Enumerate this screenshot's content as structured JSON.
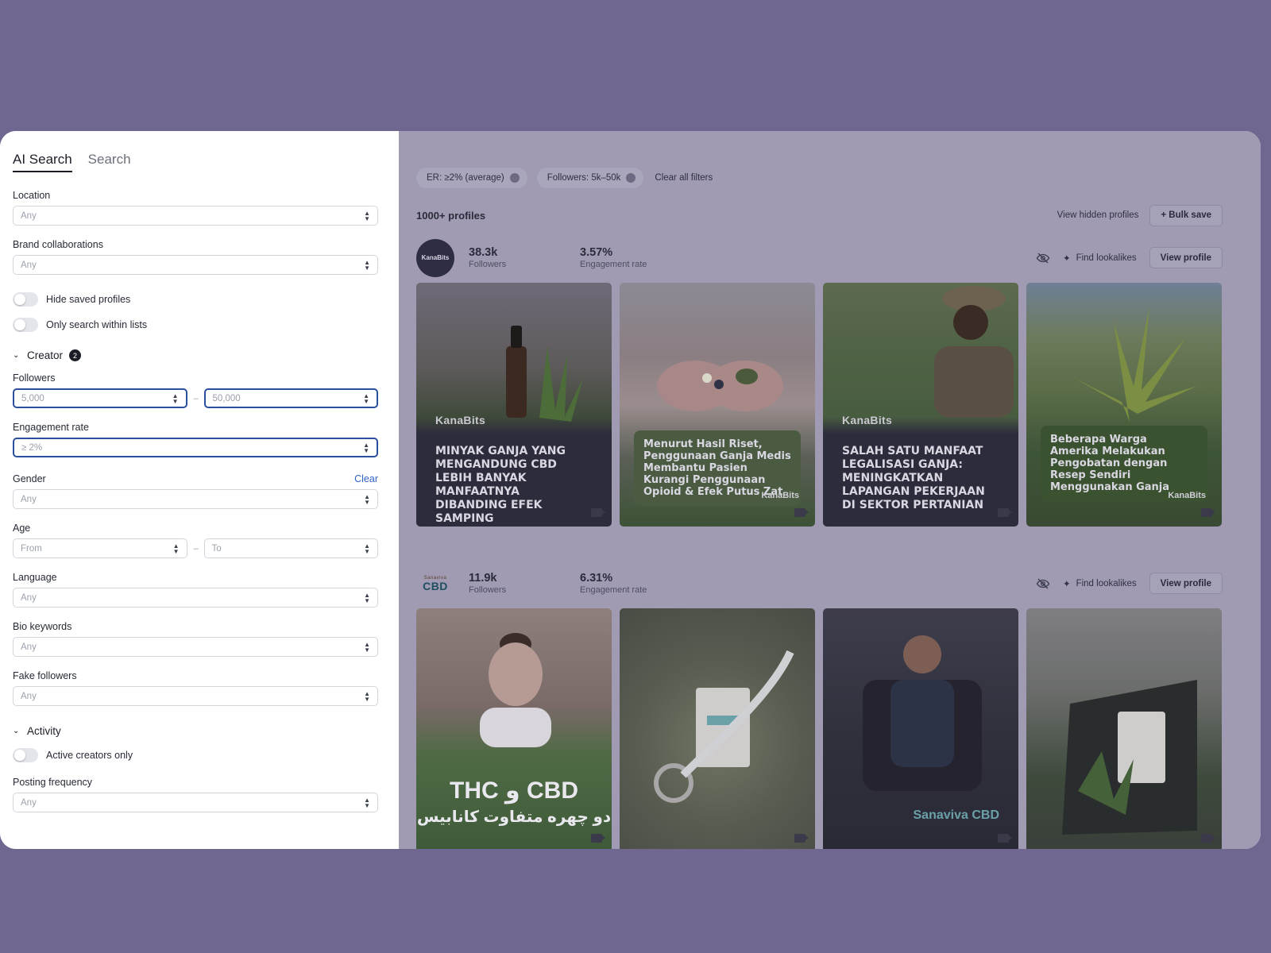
{
  "sidebar": {
    "tabs": [
      {
        "label": "AI Search"
      },
      {
        "label": "Search"
      }
    ],
    "location": {
      "label": "Location",
      "value": "Any"
    },
    "brand_collaborations": {
      "label": "Brand collaborations",
      "value": "Any"
    },
    "toggles": [
      {
        "label": "Hide saved profiles"
      },
      {
        "label": "Only search within lists"
      }
    ],
    "creator": {
      "title": "Creator",
      "badge": "2",
      "followers": {
        "label": "Followers",
        "min": "5,000",
        "max": "50,000"
      },
      "engagement": {
        "label": "Engagement rate",
        "value": "≥ 2%"
      },
      "gender": {
        "label": "Gender",
        "clear": "Clear",
        "value": "Any"
      },
      "age": {
        "label": "Age",
        "from": "From",
        "to": "To"
      },
      "language": {
        "label": "Language",
        "value": "Any"
      },
      "bio": {
        "label": "Bio keywords",
        "value": "Any"
      },
      "fake": {
        "label": "Fake followers",
        "value": "Any"
      }
    },
    "activity": {
      "title": "Activity",
      "toggle": "Active creators only",
      "posting": {
        "label": "Posting frequency",
        "value": "Any"
      }
    }
  },
  "main": {
    "filters": [
      {
        "label": "ER: ≥2% (average)"
      },
      {
        "label": "Followers: 5k–50k"
      }
    ],
    "clear_all": "Clear all filters",
    "results_count": "1000+ profiles",
    "view_hidden": "View hidden profiles",
    "bulk_save": "+ Bulk save",
    "profiles": [
      {
        "avatar": "KanaBits",
        "followers": "38.3k",
        "followers_label": "Followers",
        "er": "3.57%",
        "er_label": "Engagement rate",
        "lookalikes": "Find lookalikes",
        "view": "View profile",
        "posts": [
          {
            "brand": "KanaBits",
            "caption": "MINYAK GANJA YANG MENGANDUNG CBD LEBIH BANYAK MANFAATNYA DIBANDING EFEK SAMPING"
          },
          {
            "caption": "Menurut Hasil Riset, Penggunaan Ganja Medis Membantu Pasien Kurangi Penggunaan Opioid & Efek Putus Zat",
            "brand": "KanaBits"
          },
          {
            "brand": "KanaBits",
            "caption": "SALAH SATU MANFAAT LEGALISASI GANJA: MENINGKATKAN LAPANGAN PEKERJAAN DI SEKTOR PERTANIAN"
          },
          {
            "caption": "Beberapa Warga Amerika Melakukan Pengobatan dengan Resep Sendiri Menggunakan Ganja",
            "brand": "KanaBits"
          }
        ]
      },
      {
        "avatar_top": "Sanaviva",
        "avatar": "CBD",
        "followers": "11.9k",
        "followers_label": "Followers",
        "er": "6.31%",
        "er_label": "Engagement rate",
        "lookalikes": "Find lookalikes",
        "view": "View profile",
        "posts": [
          {
            "overlay": "THC و CBD",
            "overlay2": "دو چهره متفاوت کانابیس"
          },
          {},
          {
            "brand": "Sanaviva CBD"
          },
          {}
        ]
      }
    ]
  },
  "colors": {
    "accent": "#2a4f9c",
    "link": "#2f63c4",
    "backdrop": "#6f678f"
  }
}
